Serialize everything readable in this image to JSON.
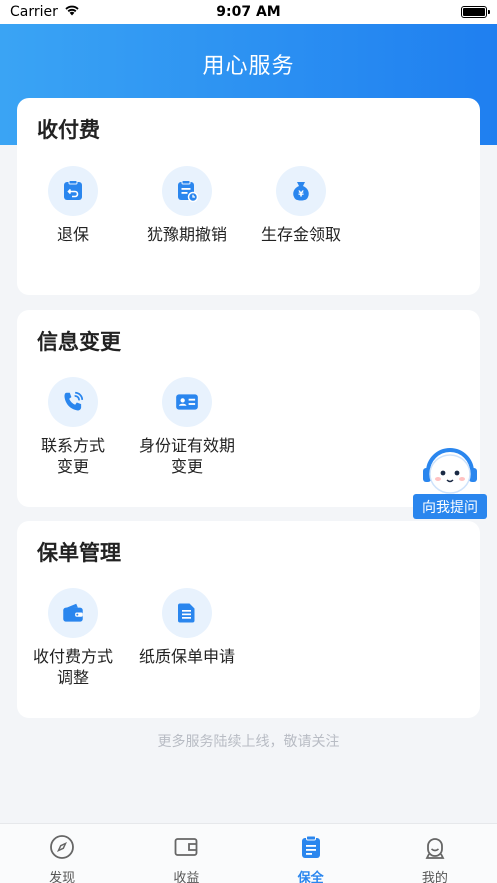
{
  "status_bar": {
    "carrier": "Carrier",
    "time": "9:07 AM"
  },
  "header": {
    "title": "用心服务"
  },
  "sections": [
    {
      "title": "收付费",
      "items": [
        {
          "label": "退保",
          "icon": "refund-icon"
        },
        {
          "label": "犹豫期撤销",
          "icon": "cancel-clipboard-icon"
        },
        {
          "label": "生存金领取",
          "icon": "money-bag-icon"
        }
      ]
    },
    {
      "title": "信息变更",
      "items": [
        {
          "label": "联系方式\n变更",
          "icon": "phone-icon"
        },
        {
          "label": "身份证有效期\n变更",
          "icon": "id-card-icon"
        }
      ]
    },
    {
      "title": "保单管理",
      "items": [
        {
          "label": "收付费方式\n调整",
          "icon": "wallet-icon"
        },
        {
          "label": "纸质保单申请",
          "icon": "document-icon"
        }
      ]
    }
  ],
  "footer_note": "更多服务陆续上线，敬请关注",
  "assistant": {
    "label": "向我提问"
  },
  "tabs": [
    {
      "label": "发现",
      "icon": "compass-icon",
      "active": false
    },
    {
      "label": "收益",
      "icon": "wallet-outline-icon",
      "active": false
    },
    {
      "label": "保全",
      "icon": "clipboard-icon",
      "active": true
    },
    {
      "label": "我的",
      "icon": "user-icon",
      "active": false
    }
  ],
  "colors": {
    "accent": "#2a86ee",
    "header_start": "#3aa4f4",
    "header_end": "#1f7ff0",
    "icon_bg": "#e8f2fd"
  }
}
